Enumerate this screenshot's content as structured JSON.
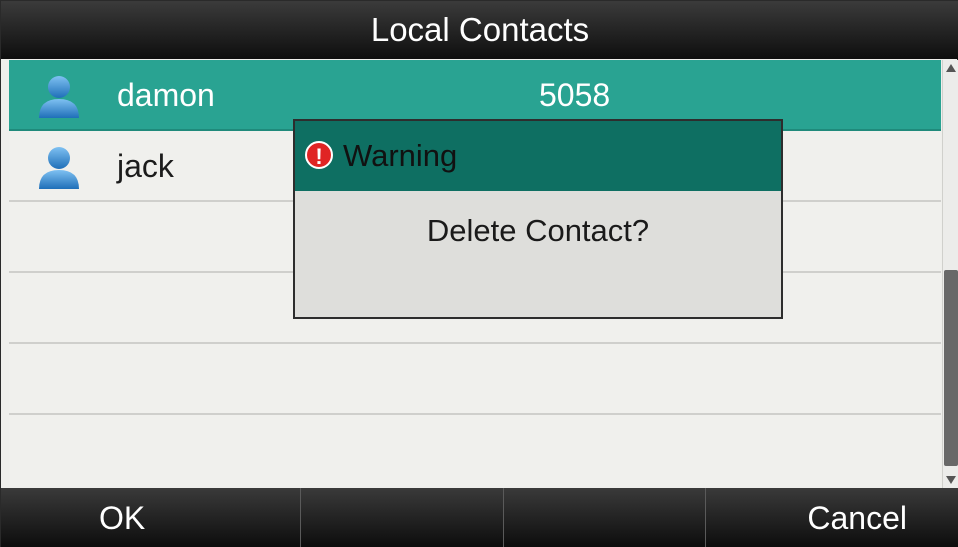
{
  "header": {
    "title": "Local Contacts"
  },
  "contacts": [
    {
      "name": "damon",
      "number": "5058",
      "selected": true,
      "icon": "contact-avatar-icon"
    },
    {
      "name": "jack",
      "number": "",
      "selected": false,
      "icon": "contact-avatar-icon"
    }
  ],
  "dialog": {
    "icon": "warning-icon",
    "icon_glyph": "!",
    "title": "Warning",
    "message": "Delete Contact?"
  },
  "softkeys": [
    "OK",
    "",
    "",
    "Cancel"
  ],
  "colors": {
    "accent": "#29a392",
    "dialog_header": "#0e6f62",
    "warning": "#e02424"
  }
}
